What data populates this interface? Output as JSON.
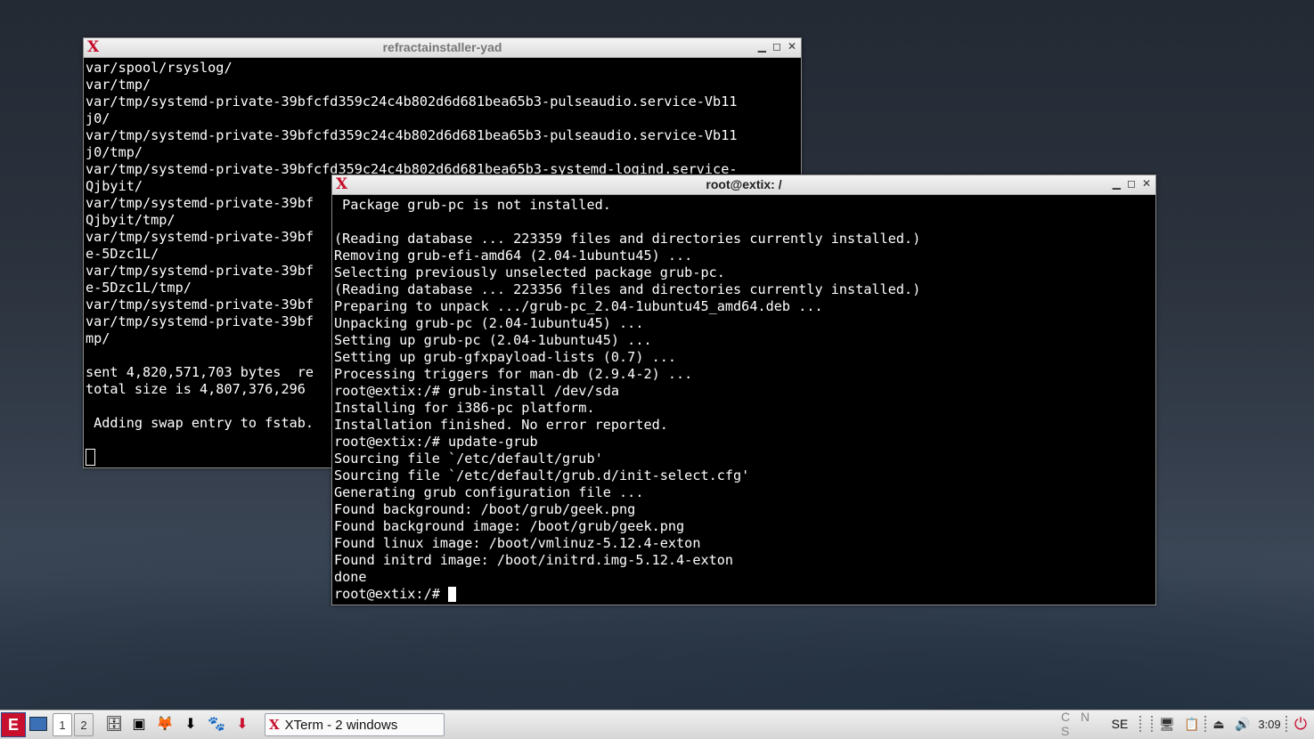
{
  "windows": {
    "installer": {
      "title": "refractainstaller-yad",
      "lines": [
        "var/spool/rsyslog/",
        "var/tmp/",
        "var/tmp/systemd-private-39bfcfd359c24c4b802d6d681bea65b3-pulseaudio.service-Vb11",
        "j0/",
        "var/tmp/systemd-private-39bfcfd359c24c4b802d6d681bea65b3-pulseaudio.service-Vb11",
        "j0/tmp/",
        "var/tmp/systemd-private-39bfcfd359c24c4b802d6d681bea65b3-systemd-logind.service-",
        "Qjbyit/",
        "var/tmp/systemd-private-39bf",
        "Qjbyit/tmp/",
        "var/tmp/systemd-private-39bf",
        "e-5Dzc1L/",
        "var/tmp/systemd-private-39bf",
        "e-5Dzc1L/tmp/",
        "var/tmp/systemd-private-39bf",
        "var/tmp/systemd-private-39bf",
        "mp/",
        "",
        "sent 4,820,571,703 bytes  re",
        "total size is 4,807,376,296",
        "",
        " Adding swap entry to fstab."
      ]
    },
    "root_term": {
      "title": "root@extix: /",
      "lines": [
        " Package grub-pc is not installed.",
        "",
        "(Reading database ... 223359 files and directories currently installed.)",
        "Removing grub-efi-amd64 (2.04-1ubuntu45) ...",
        "Selecting previously unselected package grub-pc.",
        "(Reading database ... 223356 files and directories currently installed.)",
        "Preparing to unpack .../grub-pc_2.04-1ubuntu45_amd64.deb ...",
        "Unpacking grub-pc (2.04-1ubuntu45) ...",
        "Setting up grub-pc (2.04-1ubuntu45) ...",
        "Setting up grub-gfxpayload-lists (0.7) ...",
        "Processing triggers for man-db (2.9.4-2) ...",
        "root@extix:/# grub-install /dev/sda",
        "Installing for i386-pc platform.",
        "Installation finished. No error reported.",
        "root@extix:/# update-grub",
        "Sourcing file `/etc/default/grub'",
        "Sourcing file `/etc/default/grub.d/init-select.cfg'",
        "Generating grub configuration file ...",
        "Found background: /boot/grub/geek.png",
        "Found background image: /boot/grub/geek.png",
        "Found linux image: /boot/vmlinuz-5.12.4-exton",
        "Found initrd image: /boot/initrd.img-5.12.4-exton",
        "done"
      ],
      "prompt": "root@extix:/# "
    }
  },
  "taskbar": {
    "menu_label": "E",
    "workspaces": [
      "1",
      "2"
    ],
    "task_label": "XTerm - 2 windows",
    "keyboard_indicators": "C N S",
    "layout": "SE",
    "clock": "3:09",
    "colors": {
      "accent": "#c8102e",
      "task_bg": "#fafafa"
    }
  }
}
